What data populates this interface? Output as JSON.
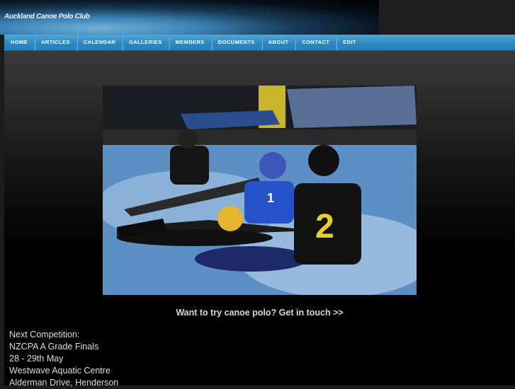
{
  "header": {
    "site_title": "Auckland Canoe Polo Club"
  },
  "nav": {
    "items": [
      "HOME",
      "ARTICLES",
      "CALENDAR",
      "GALLERIES",
      "MEMBERS",
      "DOCUMENTS",
      "ABOUT",
      "CONTACT",
      "EDIT"
    ]
  },
  "main": {
    "photo_alt": "Canoe polo players in a pool",
    "cta": "Want to try canoe polo? Get in touch >>",
    "competition": [
      "Next Competition:",
      "NZCPA A Grade Finals",
      "28 - 29th May",
      "Westwave Aquatic Centre",
      "Alderman Drive, Henderson"
    ]
  }
}
